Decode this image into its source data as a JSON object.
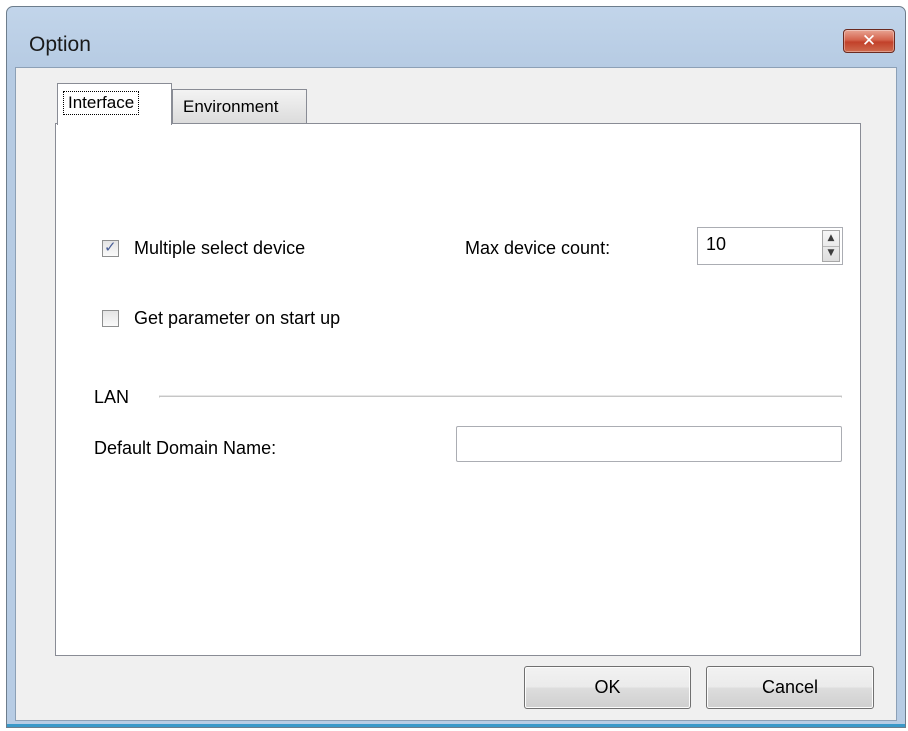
{
  "window": {
    "title": "Option",
    "close_label": "✕"
  },
  "tabs": [
    {
      "label": "Interface",
      "active": true
    },
    {
      "label": "Environment",
      "active": false
    }
  ],
  "interface": {
    "multiple_select": {
      "label": "Multiple select device",
      "checked": true,
      "check_glyph": "✓"
    },
    "max_device_count": {
      "label": "Max device count:",
      "value": "10",
      "up_arrow": "▲",
      "down_arrow": "▼"
    },
    "get_parameter": {
      "label": "Get parameter on start up",
      "checked": false
    },
    "lan_group": {
      "label": "LAN"
    },
    "default_domain": {
      "label": "Default Domain Name:",
      "value": ""
    }
  },
  "buttons": {
    "ok": "OK",
    "cancel": "Cancel"
  },
  "colors": {
    "titlebar": "#b9cee6",
    "close_button": "#c7462e",
    "client_bg": "#f0f0f0",
    "checkbox_mark": "#4a5f97",
    "bottom_accent": "#3a99c9"
  }
}
